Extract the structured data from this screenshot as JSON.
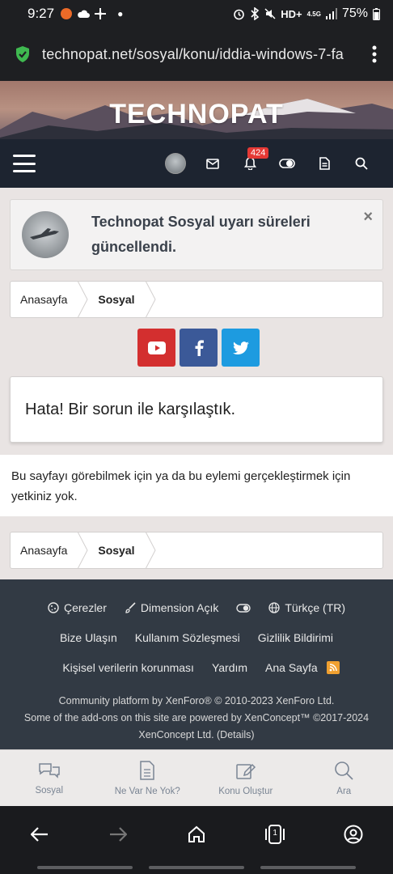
{
  "status_bar": {
    "time": "9:27",
    "network": "HD+",
    "signal_label": "4.5G",
    "battery": "75%"
  },
  "browser": {
    "url": "technopat.net/sosyal/konu/iddia-windows-7-fa",
    "icons": [
      "shield-check-icon",
      "overflow-menu-icon"
    ]
  },
  "site": {
    "logo": "TECHNOPAT",
    "notification_count": "424"
  },
  "notice": {
    "text": "Technopat Sosyal uyarı süreleri güncellendi.",
    "close": "×"
  },
  "breadcrumb": {
    "home": "Anasayfa",
    "current": "Sosyal"
  },
  "social_buttons": [
    {
      "name": "youtube",
      "color": "#d32f2f"
    },
    {
      "name": "facebook",
      "color": "#3b5998"
    },
    {
      "name": "twitter",
      "color": "#1d9be0"
    }
  ],
  "error": {
    "title": "Hata! Bir sorun ile karşılaştık.",
    "message": "Bu sayfayı görebilmek için ya da bu eylemi gerçekleştirmek için yetkiniz yok."
  },
  "footer": {
    "row1": {
      "cookies": "Çerezler",
      "style": "Dimension Açık",
      "language": "Türkçe (TR)"
    },
    "row2": {
      "contact": "Bize Ulaşın",
      "terms": "Kullanım Sözleşmesi",
      "privacy": "Gizlilik Bildirimi"
    },
    "row3": {
      "personal_data": "Kişisel verilerin korunması",
      "help": "Yardım",
      "home": "Ana Sayfa"
    },
    "copyright1": "Community platform by XenForo® © 2010-2023 XenForo Ltd.",
    "copyright2": "Some of the add-ons on this site are powered by XenConcept™ ©2017-2024",
    "copyright3": "XenConcept Ltd. (Details)"
  },
  "bottom_nav": {
    "items": [
      "Sosyal",
      "Ne Var Ne Yok?",
      "Konu Oluştur",
      "Ara"
    ]
  },
  "system_nav": {
    "tabs_count": "1"
  }
}
